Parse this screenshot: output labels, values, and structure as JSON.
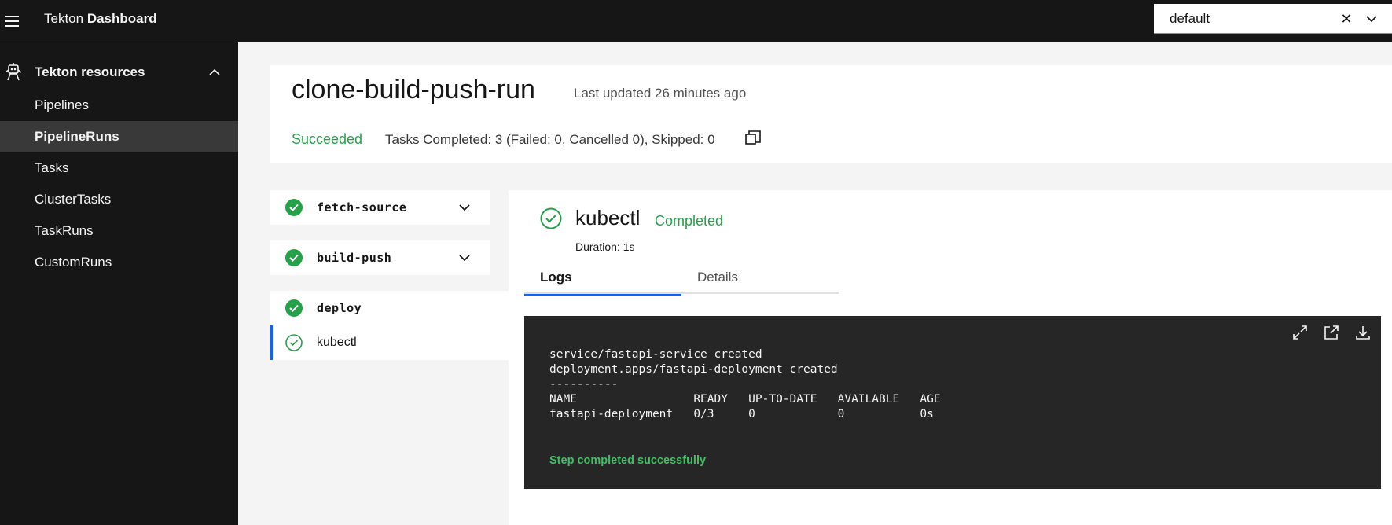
{
  "header": {
    "brand_prefix": "Tekton",
    "brand_suffix": "Dashboard",
    "namespace": {
      "value": "default",
      "clear_icon": "close-icon",
      "open_icon": "chevron-down-icon"
    }
  },
  "sidebar": {
    "section_title": "Tekton resources",
    "items": [
      {
        "label": "Pipelines"
      },
      {
        "label": "PipelineRuns"
      },
      {
        "label": "Tasks"
      },
      {
        "label": "ClusterTasks"
      },
      {
        "label": "TaskRuns"
      },
      {
        "label": "CustomRuns"
      }
    ],
    "active": "PipelineRuns"
  },
  "run": {
    "title": "clone-build-push-run",
    "last_updated": "Last updated 26 minutes ago",
    "status": "Succeeded",
    "tasks_summary": "Tasks Completed: 3 (Failed: 0, Cancelled 0), Skipped: 0"
  },
  "tasks": [
    {
      "name": "fetch-source",
      "status": "success"
    },
    {
      "name": "build-push",
      "status": "success"
    },
    {
      "name": "deploy",
      "status": "success",
      "steps": [
        {
          "name": "kubectl",
          "status": "success"
        }
      ]
    }
  ],
  "step": {
    "name": "kubectl",
    "status": "Completed",
    "duration": "Duration: 1s",
    "tabs": [
      {
        "label": "Logs"
      },
      {
        "label": "Details"
      }
    ],
    "active_tab": "Logs"
  },
  "logs": {
    "lines": [
      "service/fastapi-service created",
      "deployment.apps/fastapi-deployment created",
      "----------",
      "NAME                 READY   UP-TO-DATE   AVAILABLE   AGE",
      "fastapi-deployment   0/3     0            0           0s"
    ],
    "completion": "Step completed successfully"
  },
  "colors": {
    "success": "#24a148",
    "success_log": "#42be65",
    "accent": "#0f62fe",
    "header_bg": "#161616",
    "log_bg": "#262626"
  }
}
